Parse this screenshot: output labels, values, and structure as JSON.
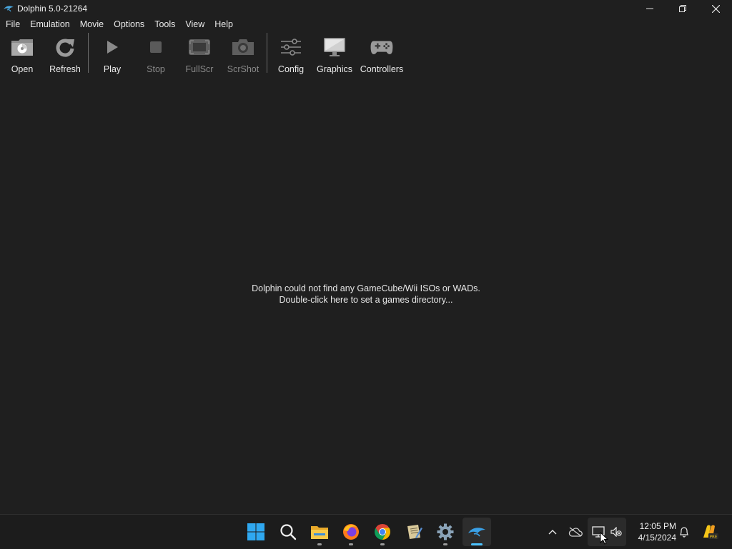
{
  "window": {
    "title": "Dolphin 5.0-21264",
    "icon": "dolphin-icon",
    "controls": [
      "minimize-icon",
      "restore-icon",
      "close-icon"
    ]
  },
  "menu": [
    "File",
    "Emulation",
    "Movie",
    "Options",
    "Tools",
    "View",
    "Help"
  ],
  "toolbar": [
    {
      "label": "Open",
      "icon": "open-folder-icon",
      "enabled": true
    },
    {
      "label": "Refresh",
      "icon": "refresh-icon",
      "enabled": true
    },
    {
      "label": "Play",
      "icon": "play-icon",
      "enabled": true
    },
    {
      "label": "Stop",
      "icon": "stop-icon",
      "enabled": false
    },
    {
      "label": "FullScr",
      "icon": "fullscreen-icon",
      "enabled": false
    },
    {
      "label": "ScrShot",
      "icon": "screenshot-icon",
      "enabled": false
    },
    {
      "label": "Config",
      "icon": "config-sliders-icon",
      "enabled": true
    },
    {
      "label": "Graphics",
      "icon": "graphics-monitor-icon",
      "enabled": true
    },
    {
      "label": "Controllers",
      "icon": "gamepad-icon",
      "enabled": true
    }
  ],
  "main": {
    "line1": "Dolphin could not find any GameCube/Wii ISOs or WADs.",
    "line2": "Double-click here to set a games directory..."
  },
  "taskbar": {
    "apps": [
      {
        "name": "start-button",
        "icon": "windows-logo-icon"
      },
      {
        "name": "search-button",
        "icon": "search-icon"
      },
      {
        "name": "file-explorer",
        "icon": "folder-icon"
      },
      {
        "name": "firefox",
        "icon": "firefox-icon"
      },
      {
        "name": "chrome",
        "icon": "chrome-icon"
      },
      {
        "name": "notepad-app",
        "icon": "notepad-icon"
      },
      {
        "name": "settings",
        "icon": "gear-icon"
      },
      {
        "name": "dolphin-app",
        "icon": "dolphin-icon",
        "active": true
      }
    ],
    "tray": [
      "chevron-up-icon",
      "onedrive-offline-icon",
      "network-icon",
      "volume-muted-icon"
    ],
    "time": "12:05 PM",
    "date": "4/15/2024",
    "notification_icon": "bell-icon",
    "copilot_badge": "PRE"
  },
  "colors": {
    "background": "#1f1f1f",
    "taskbar": "#1c1c1c",
    "accent": "#4cc2ff",
    "text": "#e8e8e8",
    "disabled_text": "#8a8a8a"
  }
}
